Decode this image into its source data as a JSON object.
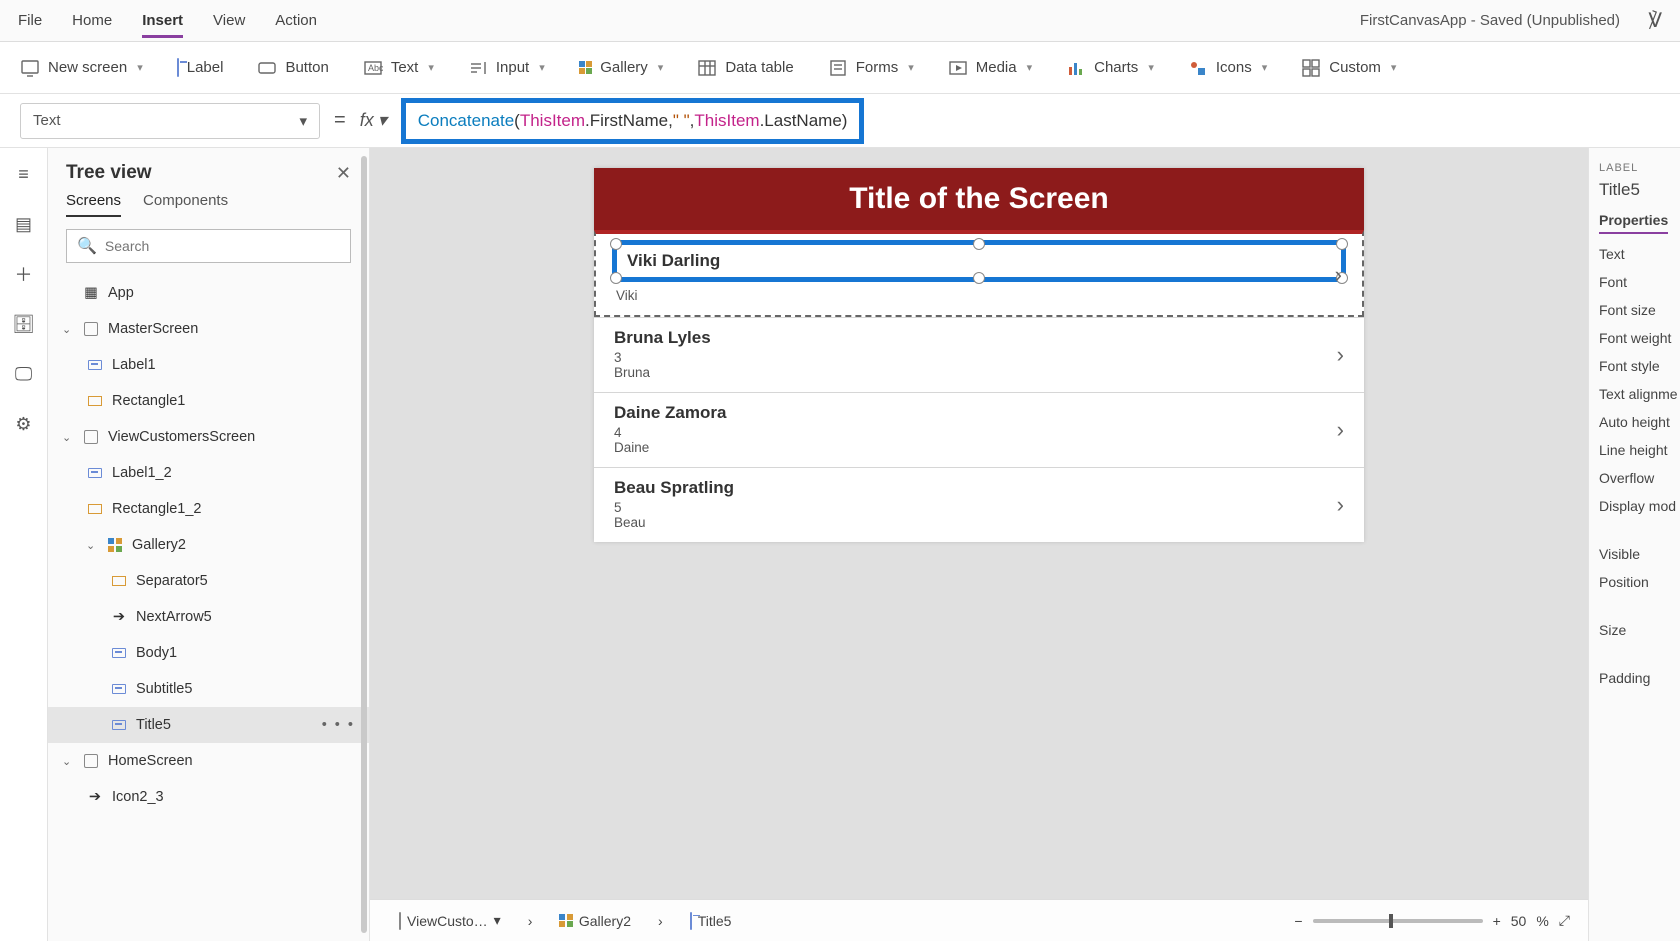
{
  "menubar": {
    "items": [
      "File",
      "Home",
      "Insert",
      "View",
      "Action"
    ],
    "active": "Insert",
    "app_title": "FirstCanvasApp - Saved (Unpublished)"
  },
  "ribbon": {
    "new_screen": "New screen",
    "label": "Label",
    "button": "Button",
    "text": "Text",
    "input": "Input",
    "gallery": "Gallery",
    "datatable": "Data table",
    "forms": "Forms",
    "media": "Media",
    "charts": "Charts",
    "icons": "Icons",
    "custom": "Custom"
  },
  "formula": {
    "property": "Text",
    "tokens": {
      "fn": "Concatenate",
      "open": "(",
      "kw1": "ThisItem",
      "dot1": ".FirstName, ",
      "str": "\" \"",
      "comma": ", ",
      "kw2": "ThisItem",
      "dot2": ".LastName",
      "close": ")"
    }
  },
  "tree": {
    "title": "Tree view",
    "tabs": {
      "screens": "Screens",
      "components": "Components"
    },
    "search_placeholder": "Search",
    "app": "App",
    "nodes": [
      {
        "name": "MasterScreen",
        "kind": "screen"
      },
      {
        "name": "Label1",
        "kind": "label"
      },
      {
        "name": "Rectangle1",
        "kind": "rect"
      },
      {
        "name": "ViewCustomersScreen",
        "kind": "screen"
      },
      {
        "name": "Label1_2",
        "kind": "label"
      },
      {
        "name": "Rectangle1_2",
        "kind": "rect"
      },
      {
        "name": "Gallery2",
        "kind": "gallery"
      },
      {
        "name": "Separator5",
        "kind": "rect"
      },
      {
        "name": "NextArrow5",
        "kind": "icon"
      },
      {
        "name": "Body1",
        "kind": "label"
      },
      {
        "name": "Subtitle5",
        "kind": "label"
      },
      {
        "name": "Title5",
        "kind": "label",
        "selected": true
      },
      {
        "name": "HomeScreen",
        "kind": "screen"
      },
      {
        "name": "Icon2_3",
        "kind": "icon"
      }
    ]
  },
  "screen": {
    "header": "Title of the Screen",
    "rows": [
      {
        "title": "Viki  Darling",
        "sub": "",
        "body": "Viki",
        "selected": true
      },
      {
        "title": "Bruna  Lyles",
        "sub": "3",
        "body": "Bruna"
      },
      {
        "title": "Daine  Zamora",
        "sub": "4",
        "body": "Daine"
      },
      {
        "title": "Beau  Spratling",
        "sub": "5",
        "body": "Beau"
      }
    ]
  },
  "breadcrumbs": {
    "a": "ViewCusto…",
    "b": "Gallery2",
    "c": "Title5"
  },
  "zoom": {
    "pct": "50",
    "unit": "%"
  },
  "props": {
    "label": "LABEL",
    "name": "Title5",
    "tab": "Properties",
    "rows": [
      "Text",
      "Font",
      "Font size",
      "Font weight",
      "Font style",
      "Text alignme",
      "Auto height",
      "Line height",
      "Overflow",
      "Display mod",
      "Visible",
      "Position",
      "Size",
      "Padding"
    ]
  }
}
